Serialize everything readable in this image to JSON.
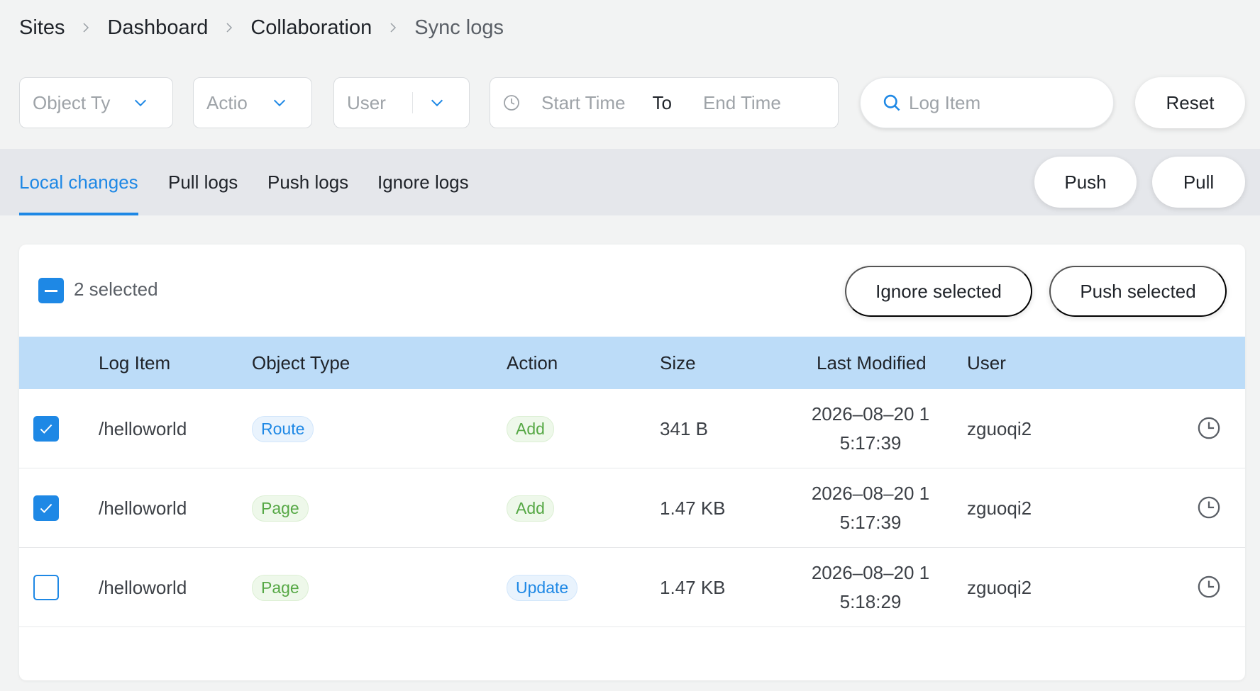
{
  "breadcrumb": [
    "Sites",
    "Dashboard",
    "Collaboration",
    "Sync logs"
  ],
  "filters": {
    "object_type_placeholder": "Object Ty",
    "action_placeholder": "Actio",
    "user_placeholder": "User",
    "start_time_placeholder": "Start Time",
    "to_label": "To",
    "end_time_placeholder": "End Time",
    "search_placeholder": "Log Item",
    "reset_label": "Reset"
  },
  "tabs": [
    {
      "label": "Local changes",
      "active": true
    },
    {
      "label": "Pull logs",
      "active": false
    },
    {
      "label": "Push logs",
      "active": false
    },
    {
      "label": "Ignore logs",
      "active": false
    }
  ],
  "tab_actions": {
    "push_label": "Push",
    "pull_label": "Pull"
  },
  "selection": {
    "text": "2 selected",
    "ignore_label": "Ignore selected",
    "push_label": "Push selected"
  },
  "table": {
    "headers": [
      "Log Item",
      "Object Type",
      "Action",
      "Size",
      "Last Modified",
      "User"
    ],
    "rows": [
      {
        "checked": true,
        "item": "/helloworld",
        "type": "Route",
        "type_color": "blue",
        "action": "Add",
        "action_color": "green",
        "size": "341 B",
        "modified_1": "2026–08–20 1",
        "modified_2": "5:17:39",
        "user": "zguoqi2"
      },
      {
        "checked": true,
        "item": "/helloworld",
        "type": "Page",
        "type_color": "green",
        "action": "Add",
        "action_color": "green",
        "size": "1.47 KB",
        "modified_1": "2026–08–20 1",
        "modified_2": "5:17:39",
        "user": "zguoqi2"
      },
      {
        "checked": false,
        "item": "/helloworld",
        "type": "Page",
        "type_color": "green",
        "action": "Update",
        "action_color": "blue",
        "size": "1.47 KB",
        "modified_1": "2026–08–20 1",
        "modified_2": "5:18:29",
        "user": "zguoqi2"
      }
    ]
  },
  "colors": {
    "accent": "#1e88e5",
    "header_bg": "#bcdcf8",
    "tag_green": "#56a845"
  },
  "icons": [
    "chevron-right-icon",
    "chevron-down-icon",
    "clock-icon",
    "search-icon",
    "check-icon",
    "history-icon"
  ]
}
